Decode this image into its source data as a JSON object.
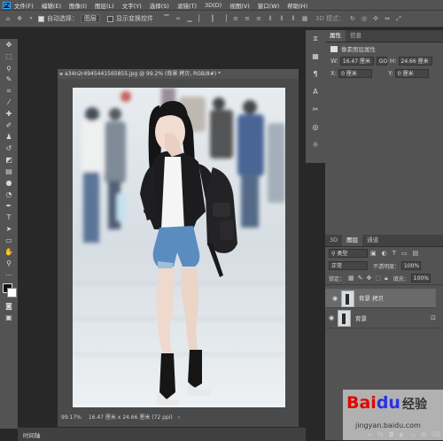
{
  "menu": {
    "app_icon": "Ps",
    "items": [
      "文件(F)",
      "编辑(E)",
      "图像(I)",
      "图层(L)",
      "文字(Y)",
      "选择(S)",
      "滤镜(T)",
      "3D(D)",
      "视图(V)",
      "窗口(W)",
      "帮助(H)"
    ]
  },
  "options": {
    "auto_select_label": "自动选择：",
    "auto_select_value": "图层",
    "show_transform_label": "显示变换控件",
    "mode_3d_label": "3D 模式："
  },
  "document": {
    "tab_title": "a34n2r4945441565855.jpg @ 99.2% (背景 拷贝, RGB/8#) *",
    "status_zoom": "99.17%",
    "status_size": "16.47 厘米 x 24.66 厘米 (72 ppi)"
  },
  "timeline": {
    "label": "时间轴"
  },
  "properties": {
    "tabs": [
      "属性",
      "信息"
    ],
    "kind": "像素图层属性",
    "w_label": "W:",
    "w_value": "16.47 厘米",
    "go_label": "GO",
    "h_label": "H:",
    "h_value": "24.66 厘米",
    "x_label": "X:",
    "x_value": "0 厘米",
    "y_label": "Y:",
    "y_value": "0 厘米"
  },
  "layers": {
    "tabs": [
      "3D",
      "图层",
      "通道"
    ],
    "filter_value": "类型",
    "blend_mode": "正常",
    "opacity_label": "不透明度：",
    "opacity_value": "100%",
    "lock_label": "锁定：",
    "fill_label": "填充：",
    "fill_value": "100%",
    "items": [
      {
        "name": "背景 拷贝",
        "selected": true
      },
      {
        "name": "背景",
        "selected": false
      }
    ]
  },
  "watermark": {
    "brand": "Bai",
    "paw": "du",
    "jingyan": "经验",
    "url": "jingyan.baidu.com"
  },
  "colors": {
    "ui_bg": "#535353",
    "workspace": "#282828",
    "accent_ps": "#31a8ff",
    "baidu_red": "#e10602",
    "baidu_blue": "#2932e1"
  }
}
